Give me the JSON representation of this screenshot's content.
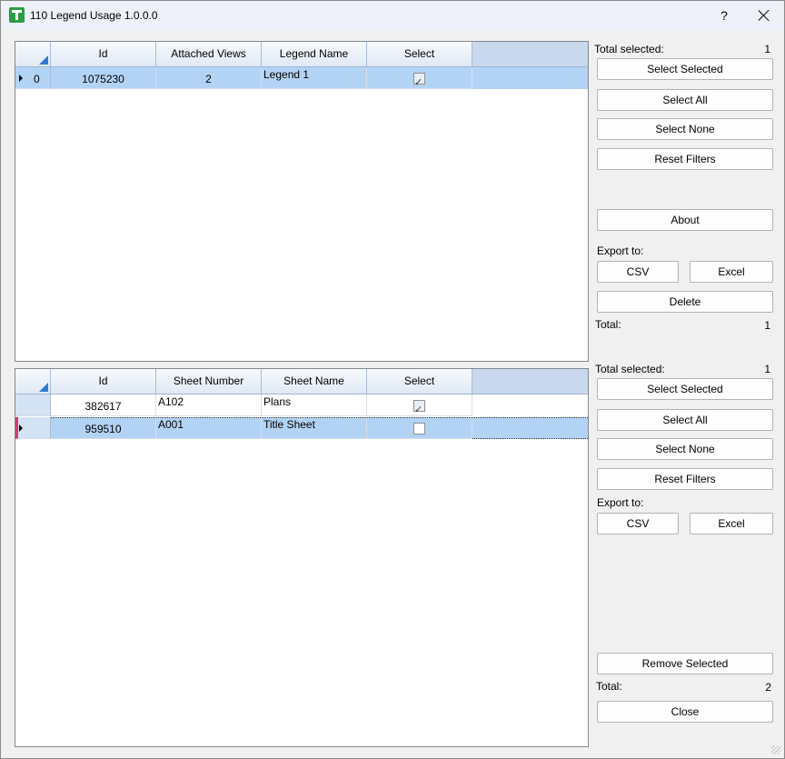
{
  "window": {
    "title": "110 Legend Usage 1.0.0.0",
    "help_label": "?"
  },
  "top_grid": {
    "columns": [
      "Id",
      "Attached Views",
      "Legend Name",
      "Select"
    ],
    "rows": [
      {
        "index": "0",
        "id": "1075230",
        "attached_views": "2",
        "legend_name": "Legend 1",
        "selected": true
      }
    ]
  },
  "bottom_grid": {
    "columns": [
      "Id",
      "Sheet Number",
      "Sheet Name",
      "Select"
    ],
    "rows": [
      {
        "id": "382617",
        "sheet_number": "A102",
        "sheet_name": "Plans",
        "selected": true
      },
      {
        "id": "959510",
        "sheet_number": "A001",
        "sheet_name": "Title Sheet",
        "selected": false
      }
    ]
  },
  "top_panel": {
    "total_selected_label": "Total selected:",
    "total_selected_value": "1",
    "select_selected": "Select Selected",
    "select_all": "Select All",
    "select_none": "Select None",
    "reset_filters": "Reset Filters",
    "about": "About",
    "export_to_label": "Export to:",
    "csv": "CSV",
    "excel": "Excel",
    "delete": "Delete",
    "total_label": "Total:",
    "total_value": "1"
  },
  "bottom_panel": {
    "total_selected_label": "Total selected:",
    "total_selected_value": "1",
    "select_selected": "Select Selected",
    "select_all": "Select All",
    "select_none": "Select None",
    "reset_filters": "Reset Filters",
    "export_to_label": "Export to:",
    "csv": "CSV",
    "excel": "Excel",
    "remove_selected": "Remove Selected",
    "total_label": "Total:",
    "total_value": "2",
    "close": "Close"
  }
}
